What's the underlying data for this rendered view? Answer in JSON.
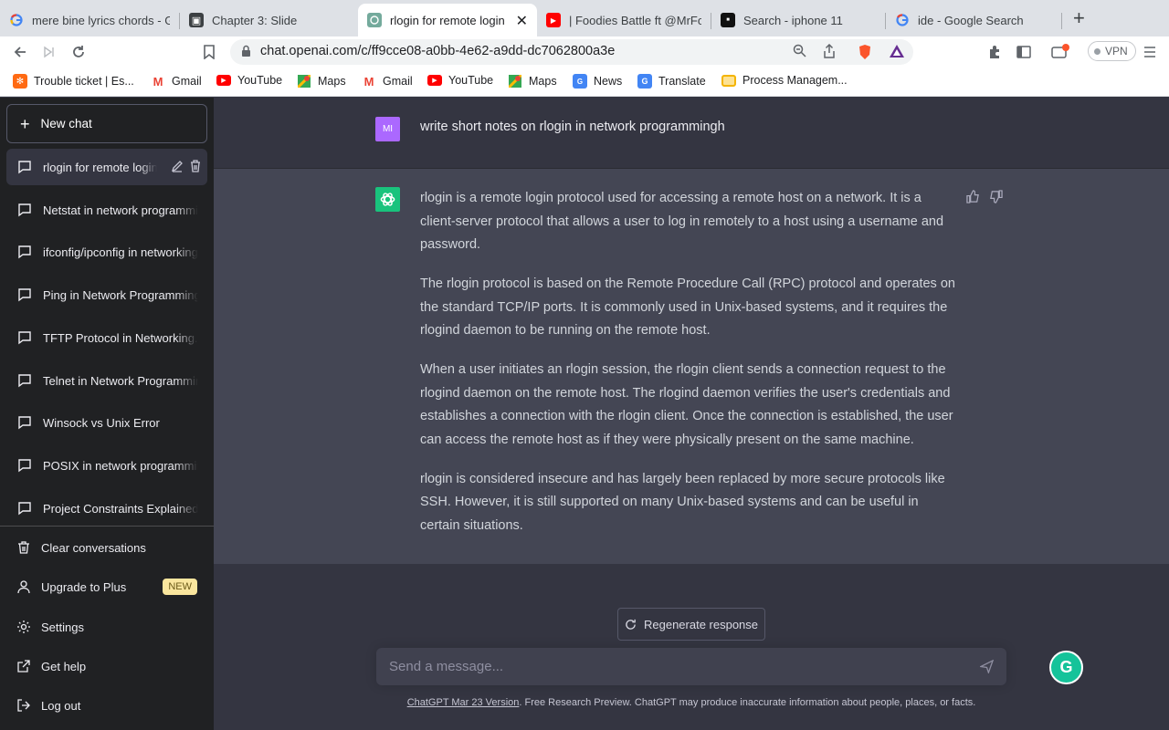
{
  "browser": {
    "tabs": [
      {
        "title": "mere bine lyrics chords - Go",
        "icon": "google-icon"
      },
      {
        "title": "Chapter 3: Slide",
        "icon": "slides-icon"
      },
      {
        "title": "rlogin for remote login",
        "icon": "chatgpt-icon",
        "active": true
      },
      {
        "title": "| Foodies Battle ft @MrFood",
        "icon": "youtube-icon"
      },
      {
        "title": "Search - iphone 11",
        "icon": "site-icon"
      },
      {
        "title": "ide - Google Search",
        "icon": "google-icon"
      }
    ],
    "url": "chat.openai.com/c/ff9cce08-a0bb-4e62-a9dd-dc7062800a3e",
    "vpn_label": "VPN",
    "bookmarks": [
      {
        "label": "Trouble ticket | Es...",
        "icon": "ticket-icon"
      },
      {
        "label": "Gmail",
        "icon": "gmail-icon"
      },
      {
        "label": "YouTube",
        "icon": "youtube-icon"
      },
      {
        "label": "Maps",
        "icon": "maps-icon"
      },
      {
        "label": "Gmail",
        "icon": "gmail-icon"
      },
      {
        "label": "YouTube",
        "icon": "youtube-icon"
      },
      {
        "label": "Maps",
        "icon": "maps-icon"
      },
      {
        "label": "News",
        "icon": "news-icon"
      },
      {
        "label": "Translate",
        "icon": "translate-icon"
      },
      {
        "label": "Process Managem...",
        "icon": "folder-icon"
      }
    ]
  },
  "sidebar": {
    "new_chat": "New chat",
    "conversations": [
      {
        "label": "rlogin for remote login",
        "active": true
      },
      {
        "label": "Netstat in network programming"
      },
      {
        "label": "ifconfig/ipconfig in networking"
      },
      {
        "label": "Ping in Network Programming."
      },
      {
        "label": "TFTP Protocol in Networking."
      },
      {
        "label": "Telnet in Network Programming"
      },
      {
        "label": "Winsock vs Unix Error"
      },
      {
        "label": "POSIX in network programming"
      },
      {
        "label": "Project Constraints Explained."
      }
    ],
    "menu": {
      "clear": "Clear conversations",
      "upgrade": "Upgrade to Plus",
      "upgrade_badge": "NEW",
      "settings": "Settings",
      "help": "Get help",
      "logout": "Log out"
    }
  },
  "chat": {
    "user_initials": "MI",
    "user_message": "write short notes on rlogin in network programmingh",
    "assistant_paragraphs": [
      "rlogin is a remote login protocol used for accessing a remote host on a network. It is a client-server protocol that allows a user to log in remotely to a host using a username and password.",
      "The rlogin protocol is based on the Remote Procedure Call (RPC) protocol and operates on the standard TCP/IP ports. It is commonly used in Unix-based systems, and it requires the rlogind daemon to be running on the remote host.",
      "When a user initiates an rlogin session, the rlogin client sends a connection request to the rlogind daemon on the remote host. The rlogind daemon verifies the user's credentials and establishes a connection with the rlogin client. Once the connection is established, the user can access the remote host as if they were physically present on the same machine.",
      "rlogin is considered insecure and has largely been replaced by more secure protocols like SSH. However, it is still supported on many Unix-based systems and can be useful in certain situations."
    ],
    "regenerate": "Regenerate response",
    "input_placeholder": "Send a message...",
    "footer_link": "ChatGPT Mar 23 Version",
    "footer_text": ". Free Research Preview. ChatGPT may produce inaccurate information about people, places, or facts.",
    "grammarly": "G"
  },
  "colors": {
    "sidebar_bg": "#202123",
    "main_bg": "#343541",
    "answer_bg": "#444654",
    "user_avatar": "#ab68ff",
    "bot_avatar": "#19c37d",
    "badge_new": "#fae69e"
  }
}
